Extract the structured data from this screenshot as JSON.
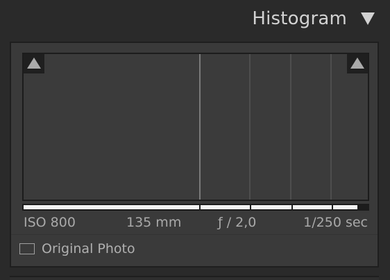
{
  "panel": {
    "title": "Histogram"
  },
  "histogram": {
    "lines": [
      {
        "position": 0.51,
        "kind": "main"
      },
      {
        "position": 0.655,
        "kind": "sub"
      },
      {
        "position": 0.775,
        "kind": "sub"
      },
      {
        "position": 0.892,
        "kind": "sub"
      }
    ],
    "left_clip_icon": "shadow-clipping-icon",
    "right_clip_icon": "highlight-clipping-icon"
  },
  "zone_bar": {
    "fill_fraction": 0.97,
    "dividers": [
      0.51,
      0.655,
      0.775,
      0.892
    ]
  },
  "exif": {
    "iso": "ISO 800",
    "focal_length": "135 mm",
    "aperture": "ƒ / 2,0",
    "shutter": "1/250 sec"
  },
  "original_photo": {
    "label": "Original Photo",
    "checked": false
  },
  "colors": {
    "background": "#2a2a2a",
    "panel": "#3a3a3a",
    "text": "#d2d2d2",
    "muted_text": "#a9a9a9"
  }
}
